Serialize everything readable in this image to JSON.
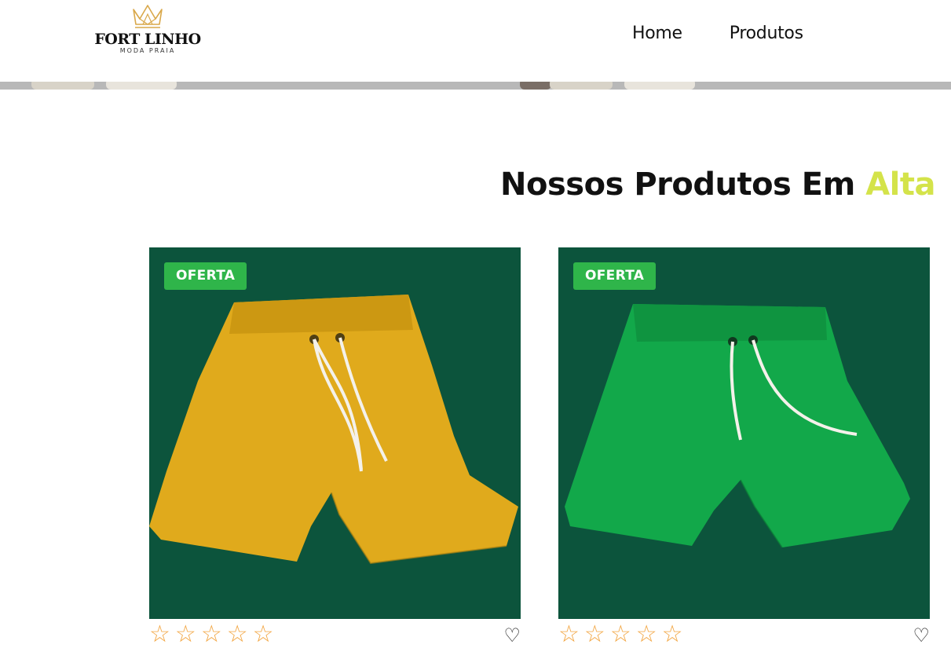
{
  "header": {
    "logo": {
      "name": "FORT LINHO",
      "tagline": "MODA PRAIA",
      "icon": "crown-icon"
    },
    "nav": [
      {
        "label": "Home"
      },
      {
        "label": "Produtos"
      }
    ]
  },
  "section": {
    "title_main": "Nossos Produtos Em ",
    "title_accent": "Alta",
    "accent_color": "#d4e34a"
  },
  "products": [
    {
      "badge": "OFERTA",
      "image": "yellow-shorts-photo",
      "shorts_color": "#e0aa1c",
      "rating": 5
    },
    {
      "badge": "OFERTA",
      "image": "green-shorts-photo",
      "shorts_color": "#12a84a",
      "rating": 5
    }
  ],
  "colors": {
    "badge": "#2fb54a",
    "star": "#f2a541",
    "photo_background": "#0e5a41"
  }
}
